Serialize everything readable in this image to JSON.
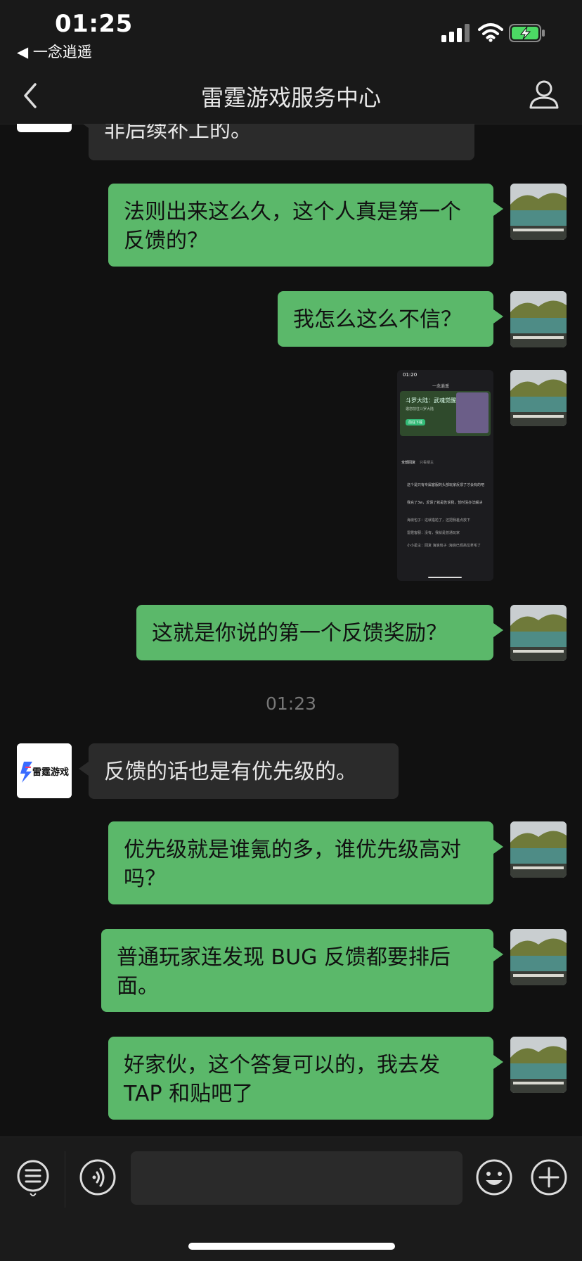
{
  "status_bar": {
    "time": "01:25",
    "back_app": "◀ 一念逍遥"
  },
  "nav": {
    "title": "雷霆游戏服务中心"
  },
  "messages": [
    {
      "side": "them",
      "text": "非后续补上的。"
    },
    {
      "side": "me",
      "text": "法则出来这么久，这个人真是第一个反馈的？"
    },
    {
      "side": "me",
      "text": "我怎么这么不信？"
    },
    {
      "side": "me",
      "type": "image"
    },
    {
      "side": "me",
      "text": "这就是你说的第一个反馈奖励？"
    },
    {
      "type": "timestamp",
      "text": "01:23"
    },
    {
      "side": "them",
      "text": "反馈的话也是有优先级的。"
    },
    {
      "side": "me",
      "text": "优先级就是谁氪的多，谁优先级高对吗？"
    },
    {
      "side": "me",
      "text": "普通玩家连发现 BUG 反馈都要排后面。"
    },
    {
      "side": "me",
      "text": "好家伙，这个答复可以的，我去发TAP 和贴吧了"
    }
  ],
  "them_avatar": {
    "logo_text": "雷霆游戏"
  },
  "screenshot_thumb": {
    "time": "01:20",
    "header": "一念逍遥",
    "banner_title": "斗罗大陆：武魂觉醒",
    "banner_line1": "邀您前往斗罗大陆",
    "banner_line2": "前往下载",
    "tabs": [
      "全部回复",
      "只看楼主"
    ],
    "lines": [
      "这个是只有专属客服的头部玩家反馈了才会有的吧",
      "我充了3w，反馈了就是告诉我，暂时没办法解决",
      "海浪包子：这就尴尬了，还把我差点放下",
      "雷霆客服：没有，我就是普通玩家",
      "小小星尘：回复 海浪包子 :海浪已经高位拿毛了"
    ]
  },
  "input": {
    "placeholder": ""
  },
  "colors": {
    "me_bubble": "#5bb86a",
    "them_bubble": "#2b2b2b",
    "background": "#111111"
  }
}
